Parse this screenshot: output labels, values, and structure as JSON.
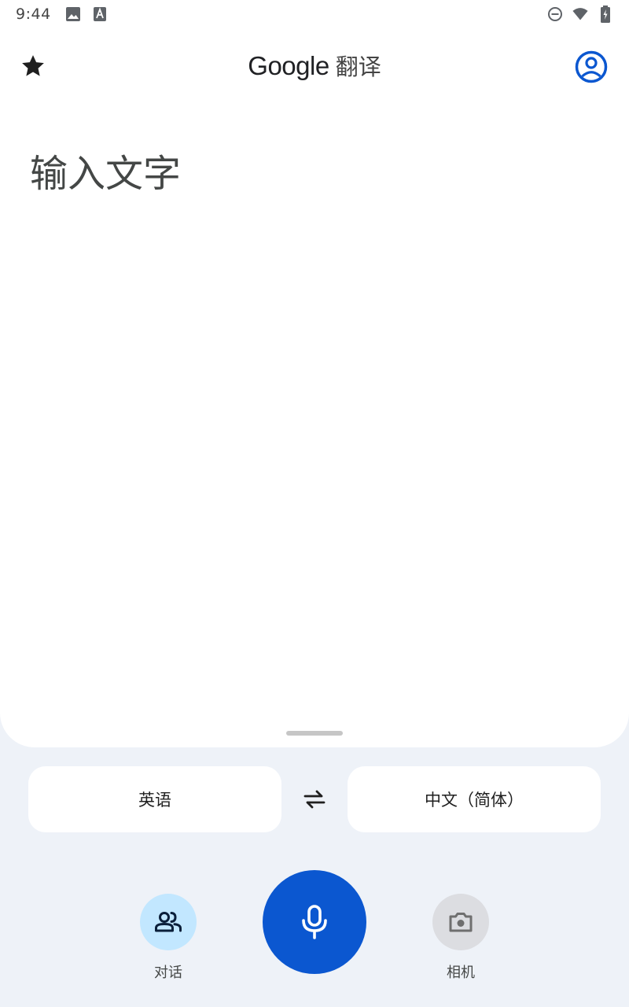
{
  "status_bar": {
    "time": "9:44",
    "left_icons": [
      "image-icon",
      "text-a-icon"
    ],
    "right_icons": [
      "do-not-disturb-icon",
      "wifi-icon",
      "battery-charging-icon"
    ]
  },
  "app_bar": {
    "brand": "Google",
    "title_suffix": "翻译",
    "icons": [
      "star-icon",
      "account-circle-icon"
    ]
  },
  "input": {
    "placeholder": "输入文字"
  },
  "languages": {
    "source": "英语",
    "target": "中文（简体）",
    "swap_icon": "swap-arrows-icon"
  },
  "actions": {
    "conversation_label": "对话",
    "camera_label": "相机",
    "mic_icon": "microphone-icon"
  },
  "colors": {
    "accent": "#0b57d0",
    "conversation_bg": "#c2e7ff",
    "camera_bg": "#dcdde1",
    "page_bg": "#eef2f8"
  }
}
